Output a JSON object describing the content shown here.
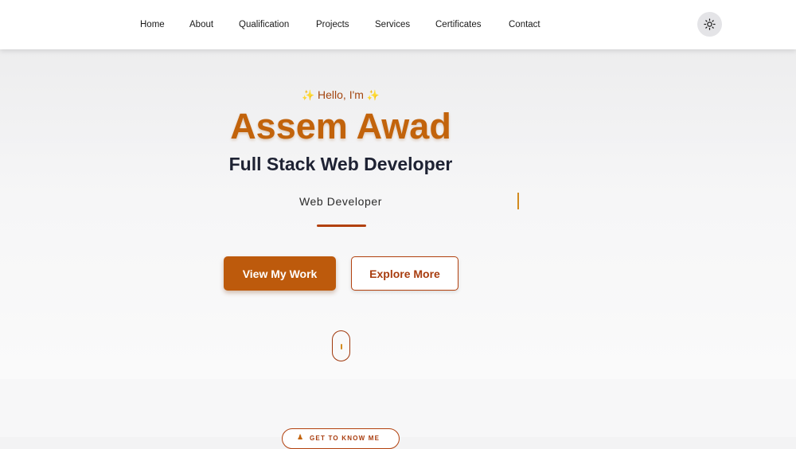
{
  "nav": {
    "items": [
      {
        "label": "Home"
      },
      {
        "label": "About"
      },
      {
        "label": "Qualification"
      },
      {
        "label": "Projects"
      },
      {
        "label": "Services"
      },
      {
        "label": "Certificates"
      },
      {
        "label": "Contact"
      }
    ],
    "theme_toggle_icon": "sun-icon"
  },
  "hero": {
    "greeting": "Hello, I'm",
    "sparkle": "✨",
    "name": "Assem Awad",
    "role": "Full Stack Web Developer",
    "typed_text": "Web Developer",
    "primary_button": "View My Work",
    "secondary_button": "Explore More",
    "scroll_icon": "mouse-scroll-icon"
  },
  "about": {
    "badge_label": "GET TO KNOW ME",
    "badge_icon": "person-icon"
  },
  "colors": {
    "accent": "#c2630b",
    "accent_dark": "#a83c0e",
    "heading": "#1e2233",
    "cursor": "#d28a1e"
  }
}
